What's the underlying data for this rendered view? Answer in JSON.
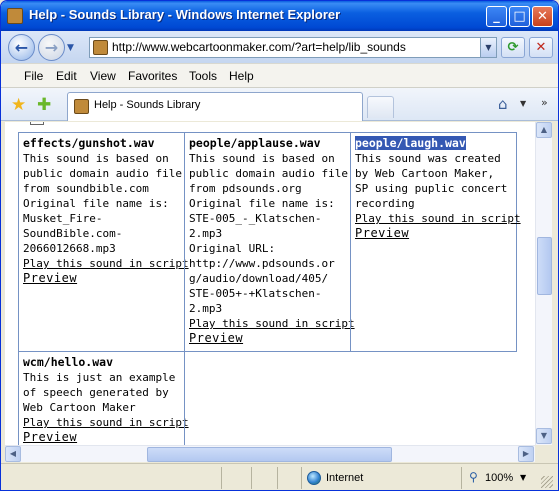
{
  "window": {
    "title": "Help - Sounds Library - Windows Internet Explorer",
    "buttons": {
      "minimize": "_",
      "maximize": "□",
      "close": "✕"
    }
  },
  "toolbar": {
    "back": "←",
    "forward": "→",
    "address": "http://www.webcartoonmaker.com/?art=help/lib_sounds",
    "refresh": "⟳",
    "stop": "✕"
  },
  "menu": [
    "File",
    "Edit",
    "View",
    "Favorites",
    "Tools",
    "Help"
  ],
  "tabs": {
    "active_label": "Help - Sounds Library"
  },
  "sounds": [
    {
      "name": "effects/gunshot.wav",
      "lines": [
        "This sound is based on",
        "public domain audio file",
        "from soundbible.com",
        "Original file name is:",
        "Musket_Fire-",
        "SoundBible.com-",
        "2066012668.mp3"
      ],
      "play": "Play this sound in script",
      "preview": "Preview",
      "selected": false
    },
    {
      "name": "people/applause.wav",
      "lines": [
        "This sound is based on",
        "public domain audio file",
        "from pdsounds.org",
        "Original file name is:",
        "STE-005_-_Klatschen-",
        "2.mp3",
        "Original URL:",
        "http://www.pdsounds.or",
        "g/audio/download/405/",
        "STE-005+-+Klatschen-",
        "2.mp3"
      ],
      "play": "Play this sound in script",
      "preview": "Preview",
      "selected": false
    },
    {
      "name": "people/laugh.wav",
      "lines": [
        "This sound was created",
        "by Web Cartoon Maker,",
        "SP using puplic concert",
        "recording"
      ],
      "play": "Play this sound in script",
      "preview": "Preview",
      "selected": true
    },
    {
      "name": "wcm/hello.wav",
      "lines": [
        "This is just an example",
        "of speech generated by",
        "Web Cartoon Maker"
      ],
      "play": "Play this sound in script",
      "preview": "Preview",
      "selected": false
    }
  ],
  "status": {
    "zone": "Internet",
    "zoom": "100%"
  },
  "colors": {
    "titlebar": "#0a5fe0",
    "link_underline": "#000000",
    "selection": "#3458b3",
    "cell_border": "#7592c4"
  }
}
